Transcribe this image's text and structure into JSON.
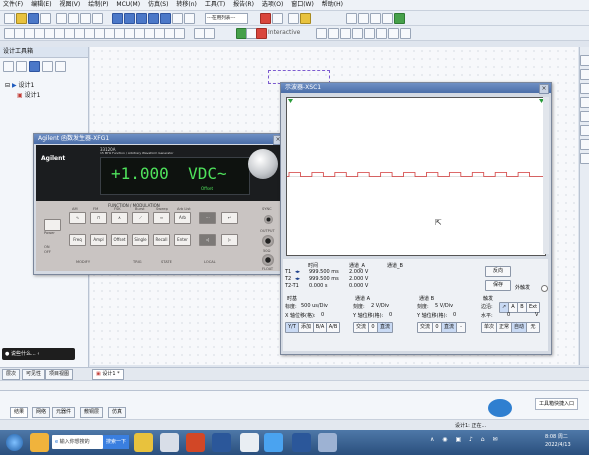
{
  "menu": [
    "文件(F)",
    "编辑(E)",
    "视图(V)",
    "绘制(P)",
    "MCU(M)",
    "仿真(S)",
    "转移(n)",
    "工具(T)",
    "报告(R)",
    "选项(O)",
    "窗口(W)",
    "帮助(H)"
  ],
  "toolbar": {
    "dropdown_value": "---在用列表---",
    "interactive_label": "Interactive"
  },
  "left_panel": {
    "title": "设计工具箱",
    "root": "设计1",
    "child": "设计1"
  },
  "function_generator": {
    "title": "Agilent 函数发生器-XFG1",
    "brand": "Agilent",
    "model": "33120A",
    "model_sub": "15 MHz Function / Arbitrary Waveform Generator",
    "display": "+1.000  VDC~",
    "display_sub": "Offset",
    "section_label": "FUNCTION / MODULATION",
    "row1_labels": [
      "AM",
      "FM",
      "FSK",
      "Burst",
      "Sweep",
      "Arb List"
    ],
    "row2_labels": [
      "Freq",
      "Ampl",
      "Offset",
      "Single",
      "Recall",
      "Enter"
    ],
    "left_labels": [
      "Power",
      "ON",
      "OFF"
    ],
    "bottom_labels": [
      "MODIFY",
      "TRIG",
      "STATE",
      "LOCAL"
    ],
    "right_labels": [
      "SYNC",
      "OUTPUT",
      "50Ω",
      "FLOAT"
    ]
  },
  "oscilloscope": {
    "title": "示波器-XSC1",
    "readout_headers": [
      "时间",
      "通道_A",
      "通道_B"
    ],
    "rows": [
      {
        "label": "T1",
        "time": "999.500 ms",
        "a": "2.000 V",
        "b": ""
      },
      {
        "label": "T2",
        "time": "999.500 ms",
        "a": "2.000 V",
        "b": ""
      },
      {
        "label": "T2-T1",
        "time": "0.000 s",
        "a": "0.000 V",
        "b": ""
      }
    ],
    "reverse_button": "反向",
    "save_button": "保存",
    "ext_trigger": "外触发",
    "timebase": {
      "title": "时基",
      "scale_label": "标度:",
      "scale": "500 us/Div",
      "pos_label": "X 轴位移(格):",
      "pos": "0",
      "buttons": [
        "Y/T",
        "添加",
        "B/A",
        "A/B"
      ]
    },
    "channel_a": {
      "title": "通道 A",
      "scale_label": "刻度:",
      "scale": "2 V/Div",
      "pos_label": "Y 轴位移(格):",
      "pos": "0",
      "buttons": [
        "交流",
        "0",
        "直流"
      ]
    },
    "channel_b": {
      "title": "通道 B",
      "scale_label": "刻度:",
      "scale": "5 V/Div",
      "pos_label": "Y 轴位移(格):",
      "pos": "0",
      "buttons": [
        "交流",
        "0",
        "直流",
        "-"
      ]
    },
    "trigger": {
      "title": "触发",
      "edge_label": "边沿:",
      "level_label": "水平:",
      "level": "0",
      "level_unit": "V",
      "buttons": [
        "单次",
        "正常",
        "自动",
        "无"
      ],
      "sources": [
        "A",
        "B",
        "Ext"
      ]
    },
    "waveform": {
      "high": 2.0,
      "low": 0.0,
      "cycles": 11,
      "duty": 0.5,
      "trace_color": "#d23a3a"
    }
  },
  "sheet_tab": "设计1 *",
  "bottom_tabs": [
    "层次",
    "可见性",
    "项目视图"
  ],
  "output_tabs": [
    "结果",
    "网络",
    "元器件",
    "敷铜层",
    "仿真"
  ],
  "notification": {
    "text": "工具箱快捷入口"
  },
  "status": {
    "text": "设计1: 正在..."
  },
  "left_popup": {
    "text": "说些什么..."
  },
  "taskbar": {
    "search": "输入你想搜的",
    "search_btn": "搜索一下",
    "clock_time": "8:08 周二",
    "clock_date": "2022/4/13"
  }
}
